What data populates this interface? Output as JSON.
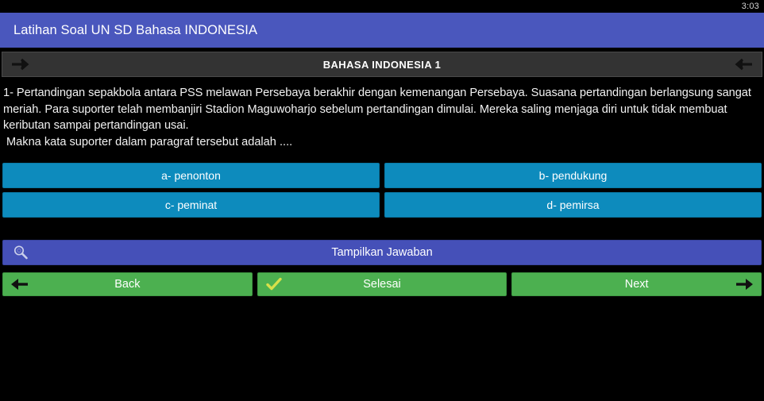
{
  "status_bar": {
    "clock": "3:03"
  },
  "app_bar": {
    "title": "Latihan Soal UN SD Bahasa INDONESIA",
    "background_color": "#4a57bd"
  },
  "section_header": {
    "title": "BAHASA INDONESIA 1",
    "left_icon": "arrow-right-icon",
    "right_icon": "arrow-left-icon",
    "left_glyph": "→",
    "right_glyph": "←",
    "background_color": "#333333"
  },
  "question": {
    "body": "1- Pertandingan sepakbola antara PSS melawan Persebaya berakhir dengan kemenangan Persebaya. Suasana pertandingan berlangsung sangat meriah. Para suporter telah membanjiri Stadion Maguwoharjo sebelum pertandingan dimulai. Mereka saling menjaga diri untuk tidak membuat keributan sampai pertandingan usai.",
    "prompt": "Makna kata suporter dalam paragraf tersebut adalah ...."
  },
  "options": {
    "accent_color": "#0d8bbd",
    "items": [
      {
        "label": "a- penonton"
      },
      {
        "label": "b- pendukung"
      },
      {
        "label": "c- peminat"
      },
      {
        "label": "d- pemirsa"
      }
    ]
  },
  "show_answer": {
    "label": "Tampilkan Jawaban",
    "icon": "search-icon",
    "background_color": "#4550b8"
  },
  "nav": {
    "accent_color": "#4cb050",
    "buttons": [
      {
        "label": "Back",
        "icon": "arrow-left-icon",
        "icon_side": "left"
      },
      {
        "label": "Selesai",
        "icon": "check-icon",
        "icon_side": "left"
      },
      {
        "label": "Next",
        "icon": "arrow-right-icon",
        "icon_side": "right"
      }
    ]
  }
}
